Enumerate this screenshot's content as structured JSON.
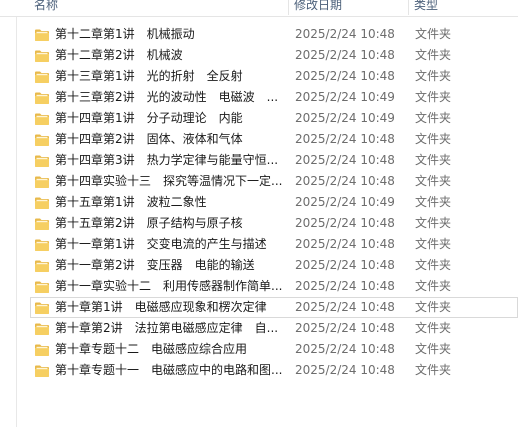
{
  "columns": {
    "name": "名称",
    "date": "修改日期",
    "type": "类型"
  },
  "folder_color": "#E8B94A",
  "items": [
    {
      "name": "第十二章第1讲　机械振动",
      "date": "2025/2/24 10:48",
      "type": "文件夹"
    },
    {
      "name": "第十二章第2讲　机械波",
      "date": "2025/2/24 10:48",
      "type": "文件夹"
    },
    {
      "name": "第十三章第1讲　光的折射　全反射",
      "date": "2025/2/24 10:48",
      "type": "文件夹"
    },
    {
      "name": "第十三章第2讲　光的波动性　电磁波　...",
      "date": "2025/2/24 10:49",
      "type": "文件夹"
    },
    {
      "name": "第十四章第1讲　分子动理论　内能",
      "date": "2025/2/24 10:49",
      "type": "文件夹"
    },
    {
      "name": "第十四章第2讲　固体、液体和气体",
      "date": "2025/2/24 10:48",
      "type": "文件夹"
    },
    {
      "name": "第十四章第3讲　热力学定律与能量守恒...",
      "date": "2025/2/24 10:48",
      "type": "文件夹"
    },
    {
      "name": "第十四章实验十三　探究等温情况下一定...",
      "date": "2025/2/24 10:48",
      "type": "文件夹"
    },
    {
      "name": "第十五章第1讲　波粒二象性",
      "date": "2025/2/24 10:49",
      "type": "文件夹"
    },
    {
      "name": "第十五章第2讲　原子结构与原子核",
      "date": "2025/2/24 10:48",
      "type": "文件夹"
    },
    {
      "name": "第十一章第1讲　交变电流的产生与描述",
      "date": "2025/2/24 10:48",
      "type": "文件夹"
    },
    {
      "name": "第十一章第2讲　变压器　电能的输送",
      "date": "2025/2/24 10:48",
      "type": "文件夹"
    },
    {
      "name": "第十一章实验十二　利用传感器制作简单...",
      "date": "2025/2/24 10:48",
      "type": "文件夹"
    },
    {
      "name": "第十章第1讲　电磁感应现象和楞次定律",
      "date": "2025/2/24 10:48",
      "type": "文件夹",
      "selected": true
    },
    {
      "name": "第十章第2讲　法拉第电磁感应定律　自...",
      "date": "2025/2/24 10:48",
      "type": "文件夹"
    },
    {
      "name": "第十章专题十二　电磁感应综合应用",
      "date": "2025/2/24 10:48",
      "type": "文件夹"
    },
    {
      "name": "第十章专题十一　电磁感应中的电路和图...",
      "date": "2025/2/24 10:48",
      "type": "文件夹"
    }
  ]
}
